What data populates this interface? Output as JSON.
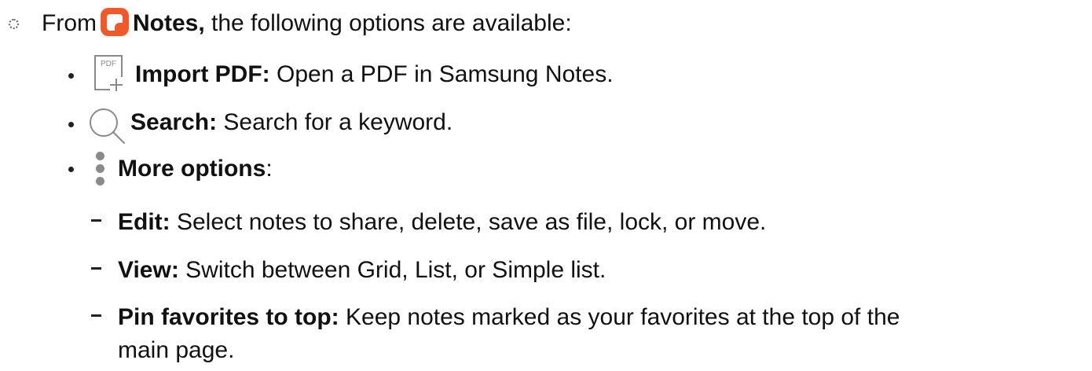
{
  "intro": {
    "prefix": "From",
    "app_name": "Notes,",
    "suffix": " the following options are available:"
  },
  "items": [
    {
      "label": "Import PDF:",
      "description": " Open a PDF in Samsung Notes.",
      "icon": "import-pdf-icon",
      "icon_text": "PDF"
    },
    {
      "label": "Search:",
      "description": " Search for a keyword.",
      "icon": "search-icon"
    },
    {
      "label": "More options",
      "description": ":",
      "icon": "more-options-icon"
    }
  ],
  "subitems": [
    {
      "label": "Edit:",
      "description": " Select notes to share, delete, save as file, lock, or move."
    },
    {
      "label": "View:",
      "description": " Switch between Grid, List, or Simple list."
    },
    {
      "label": "Pin favorites to top:",
      "description": " Keep notes marked as your favorites at the top of the",
      "continuation": "main page."
    }
  ],
  "colors": {
    "notes_icon": "#f0592a",
    "text": "#111111",
    "icon_gray": "#8a8a8a"
  }
}
